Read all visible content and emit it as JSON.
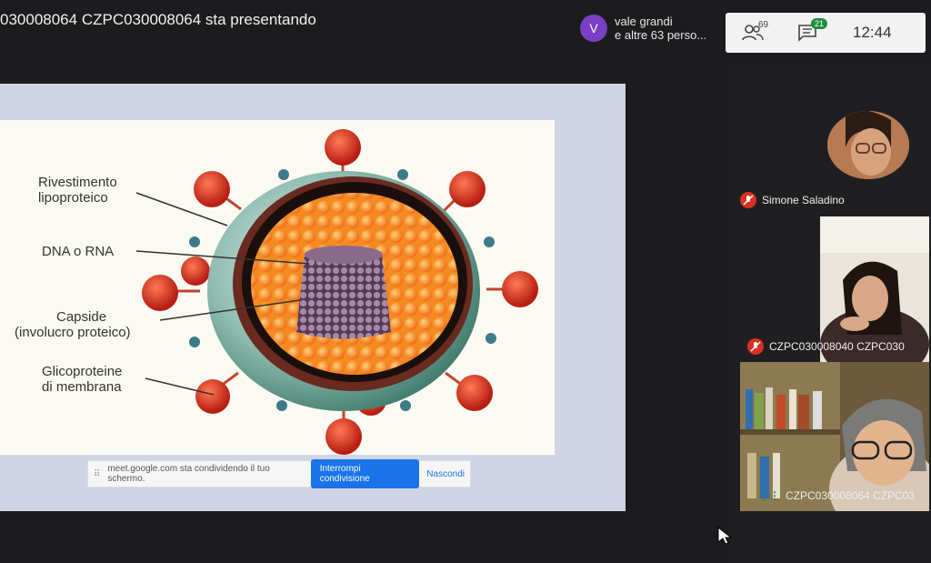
{
  "header": {
    "presenter_title": "030008064 CZPC030008064 sta presentando",
    "viewer_avatar_letter": "V",
    "viewer_text_line1": "vale grandi",
    "viewer_text_line2": "e altre 63 perso..."
  },
  "topbar": {
    "participants_count": "69",
    "chat_badge": "21",
    "clock": "12:44"
  },
  "slide": {
    "labels": {
      "rivestimento": "Rivestimento\nlipoproteico",
      "dna": "DNA o RNA",
      "capside": "Capside\n(involucro proteico)",
      "glicoproteine": "Glicoproteine\ndi membrana"
    }
  },
  "share_bar": {
    "message": "meet.google.com sta condividendo il tuo schermo.",
    "stop_button": "Interrompi condivisione",
    "hide_link": "Nascondi"
  },
  "participants": [
    {
      "name": "Simone Saladino"
    },
    {
      "name": "CZPC030008040 CZPC030"
    },
    {
      "name": "CZPC030008064 CZPC03"
    }
  ],
  "colors": {
    "accent_blue": "#1a73e8",
    "mic_off_red": "#d93025",
    "avatar_purple": "#7b3fc4"
  }
}
